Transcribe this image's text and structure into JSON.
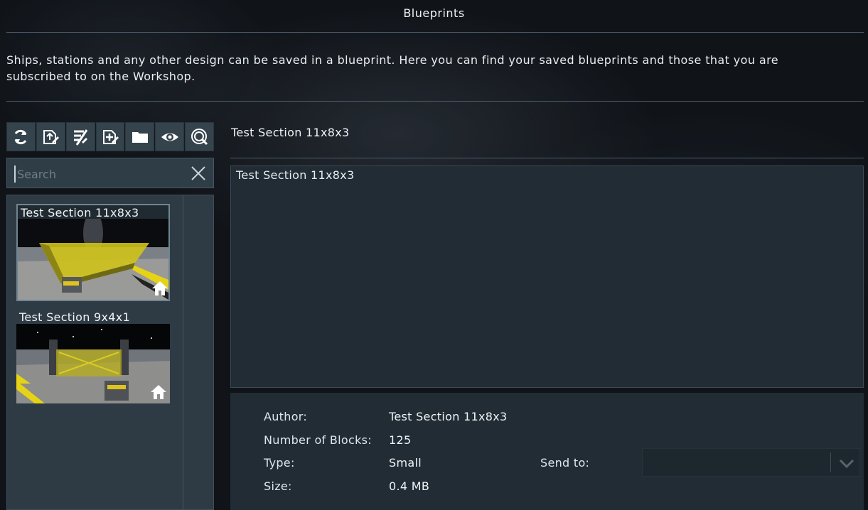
{
  "window": {
    "title": "Blueprints"
  },
  "description": "Ships, stations and any other design can be saved in a blueprint. Here you can find your saved blueprints and those that you are subscribed to on the Workshop.",
  "toolbar": {
    "buttons": [
      {
        "icon": "refresh-icon"
      },
      {
        "icon": "blueprint-edit-icon"
      },
      {
        "icon": "blueprint-delete-icon"
      },
      {
        "icon": "blueprint-new-icon"
      },
      {
        "icon": "folder-icon"
      },
      {
        "icon": "eye-icon"
      },
      {
        "icon": "workshop-search-icon"
      }
    ]
  },
  "search": {
    "placeholder": "Search",
    "value": ""
  },
  "blueprints": [
    {
      "name": "Test Section 11x8x3",
      "selected": true,
      "badge": "home-icon"
    },
    {
      "name": "Test Section 9x4x1",
      "selected": false,
      "badge": "home-icon"
    }
  ],
  "details": {
    "title": "Test Section 11x8x3",
    "description_text": "Test Section 11x8x3",
    "author_label": "Author:",
    "author_value": "Test Section 11x8x3",
    "blocks_label": "Number of Blocks:",
    "blocks_value": "125",
    "type_label": "Type:",
    "type_value": "Small",
    "size_label": "Size:",
    "size_value": "0.4 MB",
    "send_to_label": "Send to:",
    "send_to_value": ""
  },
  "colors": {
    "background": "#101419",
    "panel": "#2e3b45",
    "button": "#35434d",
    "accent_yellow": "#e1d21f",
    "text": "#e6edf2"
  }
}
